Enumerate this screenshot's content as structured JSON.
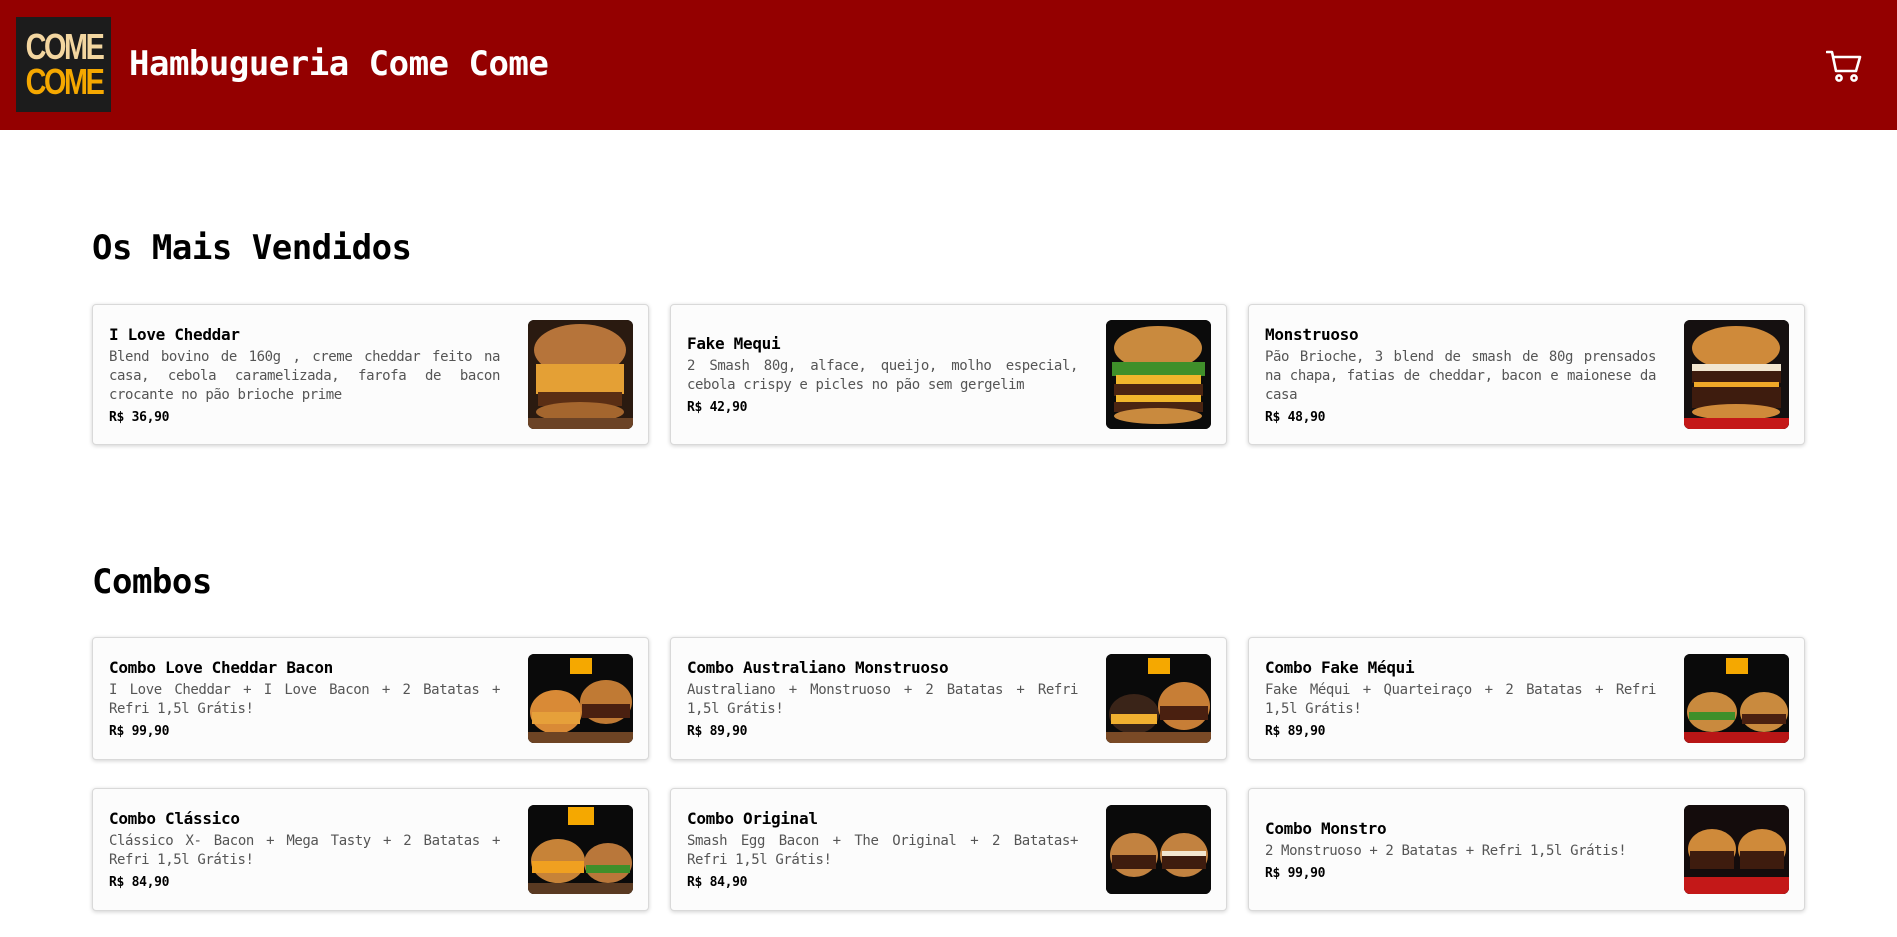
{
  "header": {
    "logo_line1": "COME",
    "logo_line2": "COME",
    "title": "Hambugueria Come Come",
    "cart_icon": "shopping-cart-icon"
  },
  "colors": {
    "header_bg": "#940000",
    "logo_bg": "#1c1c1c",
    "logo_accent": "#f5a800"
  },
  "best_sellers": {
    "title": "Os Mais Vendidos",
    "items": [
      {
        "name": "I Love Cheddar",
        "description": "Blend bovino de 160g , creme cheddar feito na casa, cebola caramelizada, farofa de bacon crocante no pão brioche prime",
        "price": "R$ 36,90"
      },
      {
        "name": "Fake Mequi",
        "description": "2 Smash 80g, alface, queijo, molho especial, cebola crispy e picles no pão sem gergelim",
        "price": "R$ 42,90"
      },
      {
        "name": "Monstruoso",
        "description": "Pão Brioche, 3 blend de smash de 80g prensados na chapa, fatias de cheddar, bacon e maionese da casa",
        "price": "R$ 48,90"
      }
    ]
  },
  "combos": {
    "title": "Combos",
    "items": [
      {
        "name": "Combo Love Cheddar Bacon",
        "description": "I Love Cheddar + I Love Bacon + 2 Batatas + Refri 1,5l Grátis!",
        "price": "R$ 99,90"
      },
      {
        "name": "Combo Australiano Monstruoso",
        "description": "Australiano + Monstruoso + 2 Batatas + Refri 1,5l Grátis!",
        "price": "R$ 89,90"
      },
      {
        "name": "Combo Fake Méqui",
        "description": "Fake Méqui + Quarteiraço + 2 Batatas + Refri 1,5l Grátis!",
        "price": "R$ 89,90"
      },
      {
        "name": "Combo Clássico",
        "description": "Clássico X- Bacon + Mega Tasty + 2 Batatas + Refri 1,5l Grátis!",
        "price": "R$ 84,90"
      },
      {
        "name": "Combo Original",
        "description": "Smash Egg Bacon + The Original + 2 Batatas+ Refri 1,5l Grátis!",
        "price": "R$ 84,90"
      },
      {
        "name": "Combo Monstro",
        "description": "2 Monstruoso + 2 Batatas + Refri 1,5l Grátis!",
        "price": "R$ 99,90"
      }
    ]
  }
}
